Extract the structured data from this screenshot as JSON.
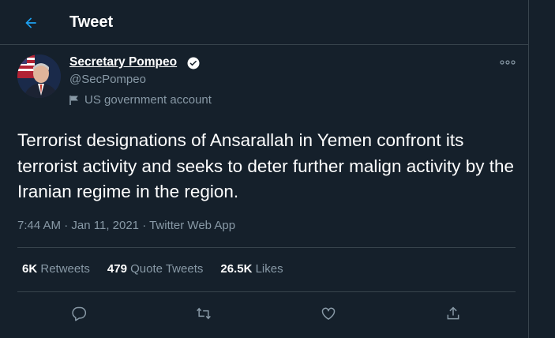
{
  "header": {
    "title": "Tweet",
    "back_icon": "arrow-left-icon"
  },
  "author": {
    "name": "Secretary Pompeo",
    "handle": "@SecPompeo",
    "label": "US government account",
    "verified_icon": "verified-badge-icon",
    "label_icon": "flag-icon"
  },
  "tweet": {
    "text": "Terrorist designations of Ansarallah in Yemen confront its terrorist activity and seeks to deter further malign activity by the Iranian regime in the region.",
    "time": "7:44 AM",
    "sep1": " · ",
    "date": "Jan 11, 2021",
    "sep2": " · ",
    "source": "Twitter Web App"
  },
  "stats": {
    "retweets_count": "6K",
    "retweets_label": "Retweets",
    "quotes_count": "479",
    "quotes_label": "Quote Tweets",
    "likes_count": "26.5K",
    "likes_label": "Likes"
  },
  "actions": [
    "reply-icon",
    "retweet-icon",
    "like-icon",
    "share-icon"
  ],
  "colors": {
    "background": "#15202b",
    "accent": "#1da1f2",
    "secondary_text": "#8899a6",
    "border": "#38444d"
  }
}
